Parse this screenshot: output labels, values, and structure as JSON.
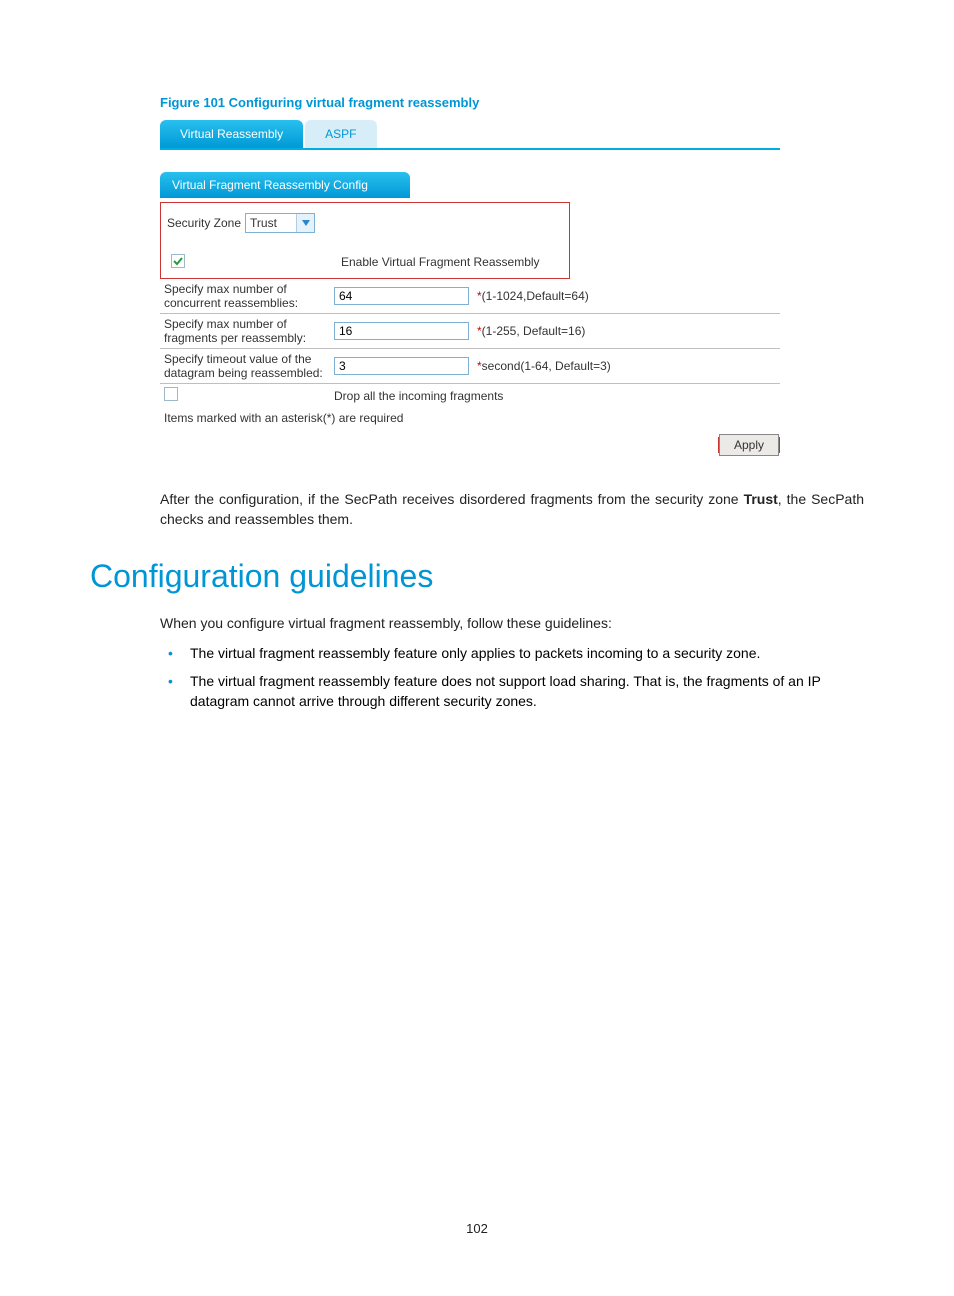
{
  "figure": {
    "caption": "Figure 101 Configuring virtual fragment reassembly"
  },
  "tabs": {
    "active": "Virtual Reassembly",
    "inactive": "ASPF"
  },
  "section_header": "Virtual Fragment Reassembly Config",
  "form": {
    "security_zone_label": "Security Zone",
    "security_zone_value": "Trust",
    "enable_label": "Enable Virtual Fragment Reassembly",
    "row1_label": "Specify max number of concurrent reassemblies:",
    "row1_value": "64",
    "row1_hint": "(1-1024,Default=64)",
    "row2_label": "Specify max number of fragments per reassembly:",
    "row2_value": "16",
    "row2_hint": "(1-255, Default=16)",
    "row3_label": "Specify timeout value of the datagram being reassembled:",
    "row3_value": "3",
    "row3_hint": "second(1-64, Default=3)",
    "drop_label": "Drop all the incoming fragments",
    "note": "Items marked with an asterisk(*) are required",
    "apply": "Apply"
  },
  "para1_pre": "After the configuration, if the SecPath receives disordered fragments from the security zone ",
  "para1_bold": "Trust",
  "para1_post": ", the SecPath checks and reassembles them.",
  "h1": "Configuration guidelines",
  "para2": "When you configure virtual fragment reassembly, follow these guidelines:",
  "bullet1": "The virtual fragment reassembly feature only applies to packets incoming to a security zone.",
  "bullet2": "The virtual fragment reassembly feature does not support load sharing. That is, the fragments of an IP datagram cannot arrive through different security zones.",
  "page_number": "102"
}
